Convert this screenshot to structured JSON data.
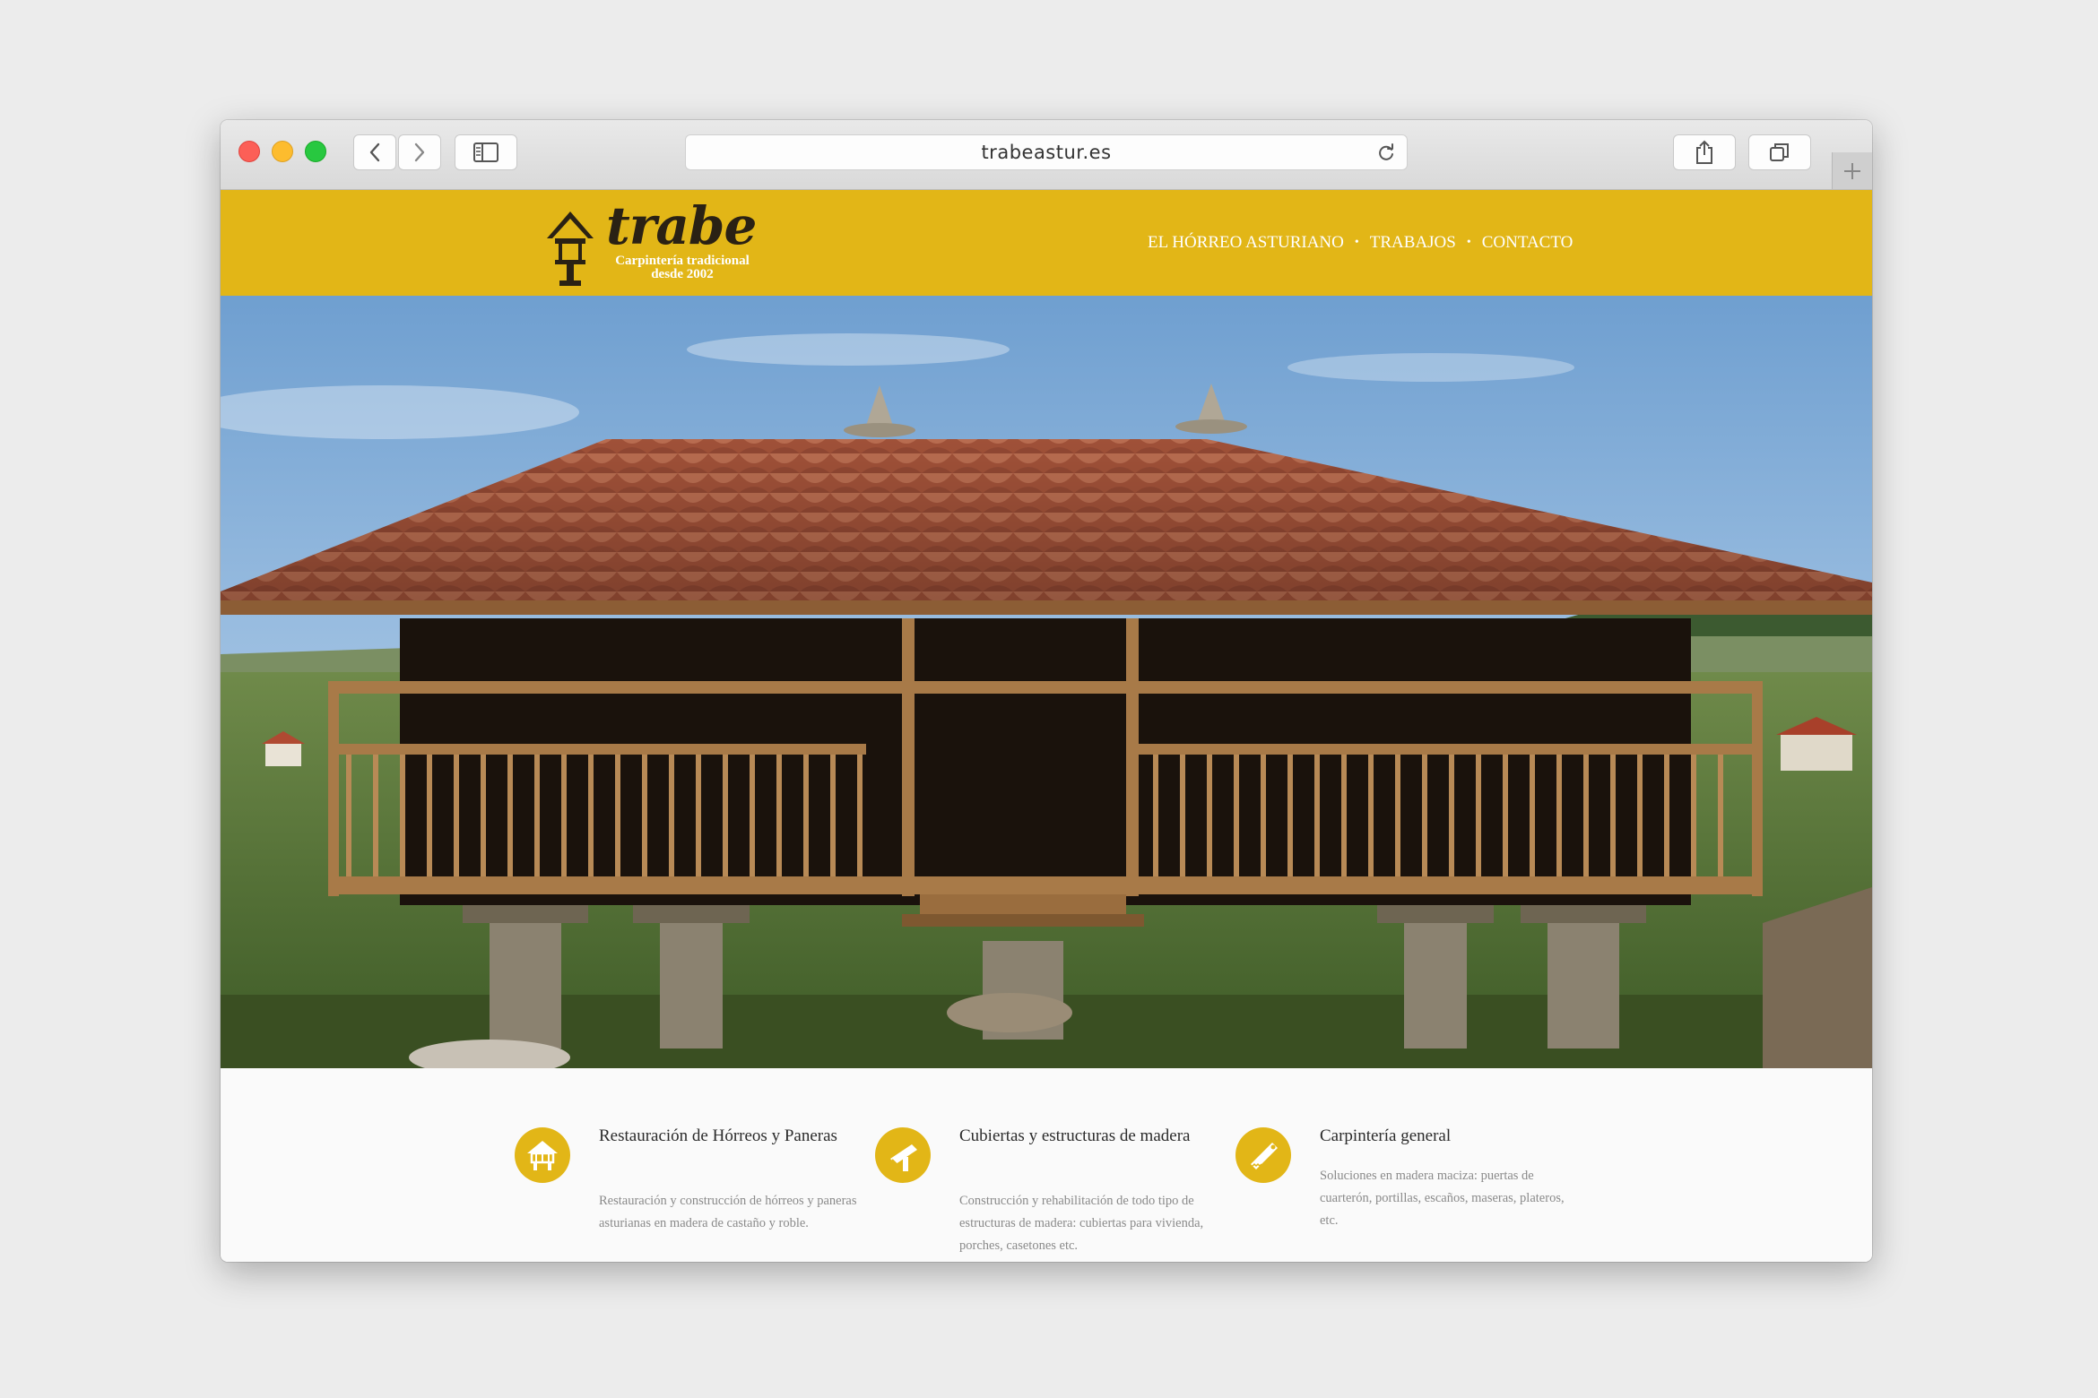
{
  "browser": {
    "url": "trabeastur.es"
  },
  "site": {
    "logo": {
      "word": "trabe",
      "tagline_line1": "Carpintería tradicional",
      "tagline_line2": "desde 2002"
    },
    "nav": [
      {
        "label": "EL HÓRREO ASTURIANO"
      },
      {
        "label": "TRABAJOS"
      },
      {
        "label": "CONTACTO"
      }
    ],
    "nav_separator": "•"
  },
  "services": [
    {
      "icon": "horreo-icon",
      "title": "Restauración de Hórreos y Paneras",
      "description": "Restauración y construcción de hórreos y paneras asturianas en madera de castaño y roble."
    },
    {
      "icon": "hammer-icon",
      "title": "Cubiertas y estructuras de madera",
      "description": "Construcción y rehabilitación de todo tipo de estructuras de madera: cubiertas para vivienda, porches, casetones etc."
    },
    {
      "icon": "saw-icon",
      "title": "Carpintería general",
      "description": "Soluciones en madera maciza: puertas de cuarterón, portillas, escaños, maseras, plateros, etc."
    }
  ],
  "colors": {
    "brand_yellow": "#e2b617",
    "header_text": "#ffffff",
    "logo_dark": "#2a2114"
  }
}
